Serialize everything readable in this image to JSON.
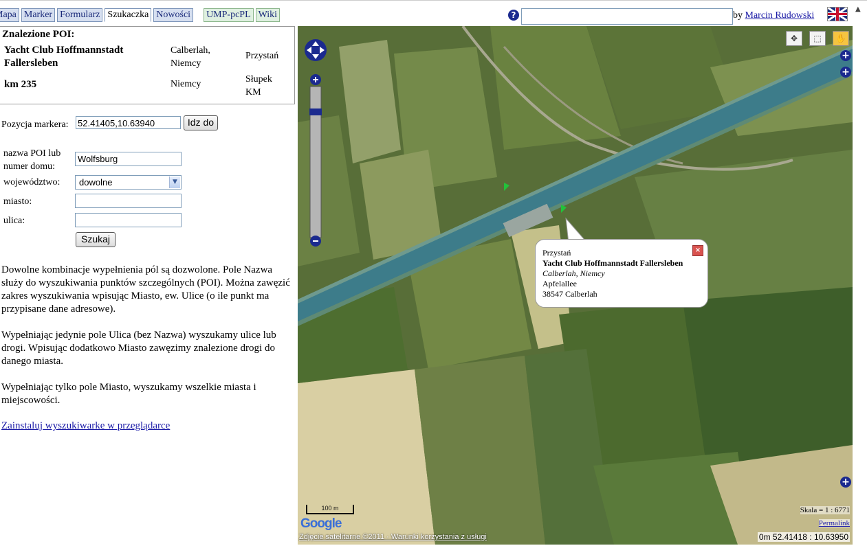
{
  "tabs": [
    {
      "label": "Mapa"
    },
    {
      "label": "Marker"
    },
    {
      "label": "Formularz"
    },
    {
      "label": "Szukaczka"
    },
    {
      "label": "Nowości"
    },
    {
      "label": "UMP-pcPL"
    },
    {
      "label": "Wiki"
    }
  ],
  "header": {
    "help_icon": "?",
    "search_value": "",
    "by_prefix": "by",
    "author": "Marcin Rudowski",
    "flag_icon": "uk-flag-icon"
  },
  "poi": {
    "title": "Znalezione POI:",
    "results": [
      {
        "name": "Yacht Club Hoffmannstadt Fallersleben",
        "place": "Calberlah, Niemcy",
        "type": "Przystań"
      },
      {
        "name": "km 235",
        "place": "Niemcy",
        "type": "Słupek KM"
      }
    ]
  },
  "marker": {
    "label": "Pozycja markera:",
    "value": "52.41405,10.63940",
    "go_button": "Idz do"
  },
  "form": {
    "name_label": "nazwa POI lub numer domu:",
    "name_value": "Wolfsburg",
    "province_label": "województwo:",
    "province_value": "dowolne",
    "city_label": "miasto:",
    "city_value": "",
    "street_label": "ulica:",
    "street_value": "",
    "search_button": "Szukaj"
  },
  "help": {
    "p1": "Dowolne kombinacje wypełnienia pól są dozwolone. Pole Nazwa służy do wyszukiwania punktów szczególnych (POI). Można zawęzić zakres wyszukiwania wpisując Miasto, ew. Ulice (o ile punkt ma przypisane dane adresowe).",
    "p2": "Wypełniając jedynie pole Ulica (bez Nazwa) wyszukamy ulice lub drogi. Wpisując dodatkowo Miasto zawęzimy znalezione drogi do danego miasta.",
    "p3": "Wypełniając tylko pole Miasto, wyszukamy wszelkie miasta i miejscowości.",
    "install_link": "Zainstaluj wyszukiwarke w przeglądarce"
  },
  "map": {
    "popup": {
      "type": "Przystań",
      "name": "Yacht Club Hoffmannstadt Fallersleben",
      "place": "Calberlah, Niemcy",
      "street": "Apfelallee",
      "postal": "38547 Calberlah"
    },
    "scale_bar": "100 m",
    "google_logo": "Google",
    "copyright": "Zdjęcie satelitarne ©2011 · Warunki korzystania z usługi",
    "scale_text": "Skala = 1 : 6771",
    "permalink": "Permalink",
    "coords": "0m 52.41418 : 10.63950",
    "colors": {
      "water": "#3d7c8a",
      "field_dark": "#4f6a32",
      "field_light": "#8a9a5c"
    }
  }
}
